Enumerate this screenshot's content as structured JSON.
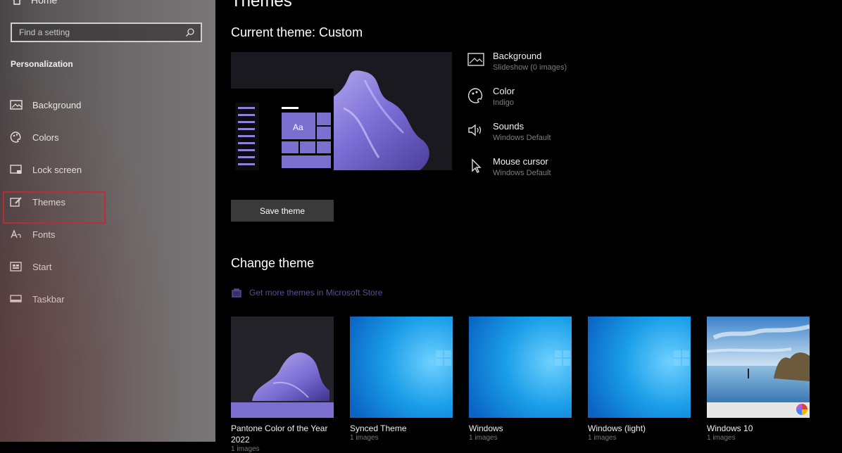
{
  "sidebar": {
    "home_label": "Home",
    "search_placeholder": "Find a setting",
    "section_title": "Personalization",
    "items": [
      {
        "label": "Background",
        "icon": "image-icon"
      },
      {
        "label": "Colors",
        "icon": "palette-icon"
      },
      {
        "label": "Lock screen",
        "icon": "lock-screen-icon"
      },
      {
        "label": "Themes",
        "icon": "themes-icon",
        "selected": true
      },
      {
        "label": "Fonts",
        "icon": "fonts-icon"
      },
      {
        "label": "Start",
        "icon": "start-icon"
      },
      {
        "label": "Taskbar",
        "icon": "taskbar-icon"
      }
    ]
  },
  "main": {
    "page_title": "Themes",
    "current_theme_title": "Current theme: Custom",
    "properties": [
      {
        "label": "Background",
        "value": "Slideshow (0 images)",
        "icon": "background-icon"
      },
      {
        "label": "Color",
        "value": "Indigo",
        "icon": "color-icon"
      },
      {
        "label": "Sounds",
        "value": "Windows Default",
        "icon": "sounds-icon"
      },
      {
        "label": "Mouse cursor",
        "value": "Windows Default",
        "icon": "mouse-cursor-icon"
      }
    ],
    "save_button_label": "Save theme",
    "change_theme_title": "Change theme",
    "store_link": "Get more themes in Microsoft Store",
    "preview_tile_text": "Aa",
    "themes": [
      {
        "name": "Pantone Color of the Year 2022",
        "count": "1 images"
      },
      {
        "name": "Synced Theme",
        "count": "1 images"
      },
      {
        "name": "Windows",
        "count": "1 images"
      },
      {
        "name": "Windows (light)",
        "count": "1 images"
      },
      {
        "name": "Windows 10",
        "count": "1 images"
      }
    ]
  },
  "colors": {
    "accent": "#7b6fd0",
    "selection_border": "#c0303a",
    "link": "#5b4f8e"
  }
}
